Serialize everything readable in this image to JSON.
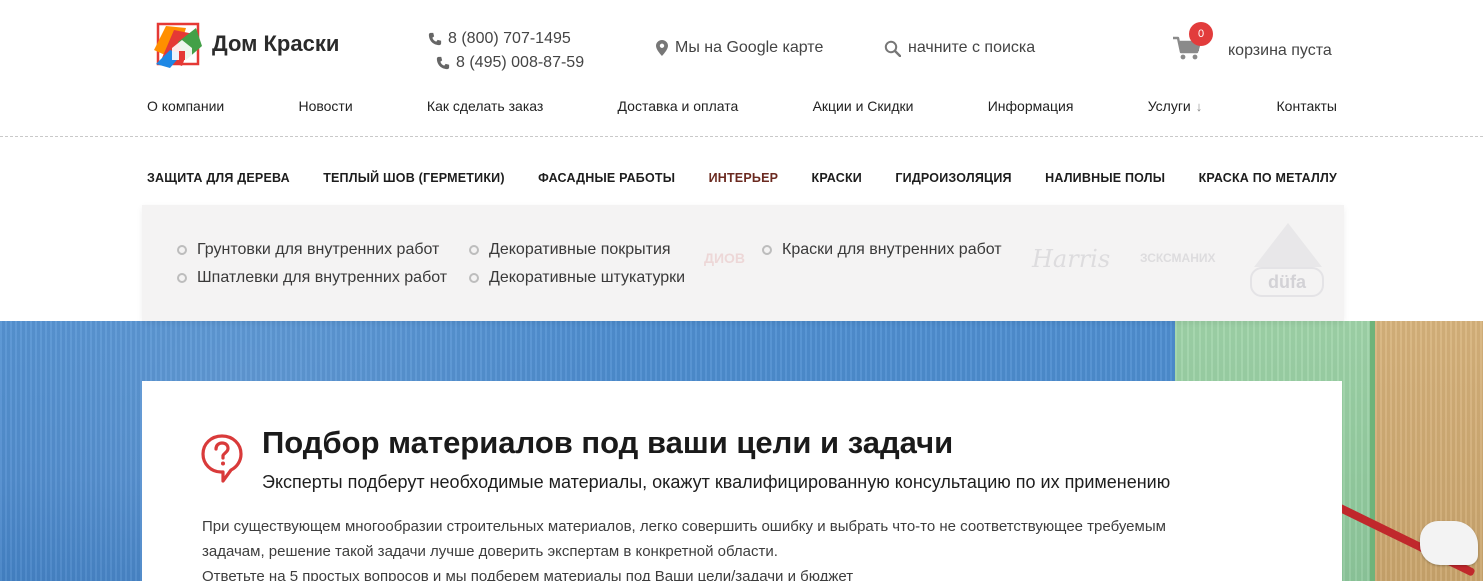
{
  "header": {
    "logo_text": "Дом Краски",
    "phones": [
      "8 (800) 707-1495",
      "8 (495) 008-87-59"
    ],
    "map_link": "Мы на Google карте",
    "search_placeholder": "начните с поиска",
    "cart": {
      "count": "0",
      "label": "корзина пуста"
    }
  },
  "main_nav": [
    "О компании",
    "Новости",
    "Как сделать заказ",
    "Доставка и оплата",
    "Акции и Скидки",
    "Информация",
    "Услуги",
    "Контакты"
  ],
  "category_nav": {
    "items": [
      "ЗАЩИТА ДЛЯ ДЕРЕВА",
      "ТЕПЛЫЙ ШОВ (ГЕРМЕТИКИ)",
      "ФАСАДНЫЕ РАБОТЫ",
      "ИНТЕРЬЕР",
      "КРАСКИ",
      "ГИДРОИЗОЛЯЦИЯ",
      "НАЛИВНЫЕ ПОЛЫ",
      "КРАСКА ПО МЕТАЛЛУ"
    ],
    "active": "ИНТЕРЬЕР"
  },
  "dropdown": {
    "col1": [
      "Грунтовки для внутренних работ",
      "Шпатлевки для внутренних работ"
    ],
    "col2": [
      "Декоративные покрытия",
      "Декоративные штукатурки"
    ],
    "col3": [
      "Краски для внутренних работ"
    ],
    "brands": {
      "harris": "Harris",
      "small": "ЗСКСМАНИХ",
      "red": "ДИОВ",
      "dufa": "düfa"
    }
  },
  "card": {
    "title": "Подбор материалов под ваши цели и задачи",
    "subtitle": "Эксперты подберут необходимые материалы, окажут квалифицированную консультацию по их применению",
    "text_1": "При существующем многообразии строительных материалов, легко совершить ошибку и выбрать что-то не соответствующее требуемым",
    "text_2": "задачам, решение такой задачи лучше доверить экспертам в конкретной области.",
    "text_3": "Ответьте на 5 простых вопросов и мы подберем материалы под Ваши цели/задачи и бюджет"
  },
  "colors": {
    "accent": "#e23c3c",
    "active_category": "#6b2a20"
  }
}
